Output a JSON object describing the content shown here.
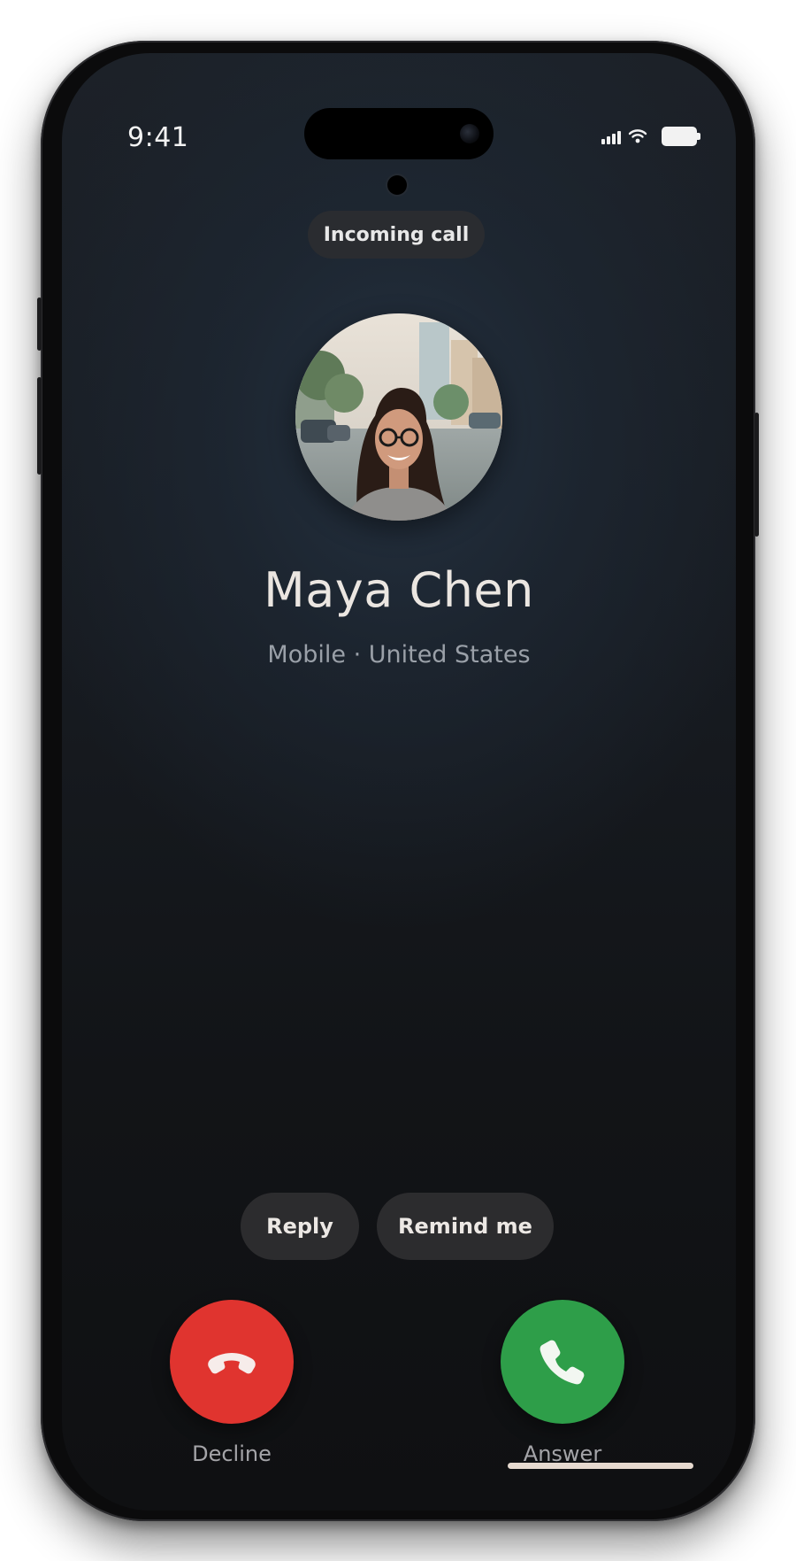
{
  "status_bar": {
    "time": "9:41",
    "signal_icon": "cellular-signal-icon",
    "wifi_icon": "wifi-icon",
    "battery_icon": "battery-icon"
  },
  "call": {
    "status_label": "Incoming call",
    "caller_name": "Maya Chen",
    "caller_detail": "Mobile · United States",
    "avatar": "caller-photo"
  },
  "quick_actions": {
    "reply_label": "Reply",
    "remind_label": "Remind me"
  },
  "actions": {
    "decline_label": "Decline",
    "answer_label": "Answer",
    "decline_icon": "phone-hangup-icon",
    "answer_icon": "phone-icon"
  },
  "colors": {
    "decline": "#e0342f",
    "answer": "#2e9e49",
    "background": "#15191e"
  }
}
